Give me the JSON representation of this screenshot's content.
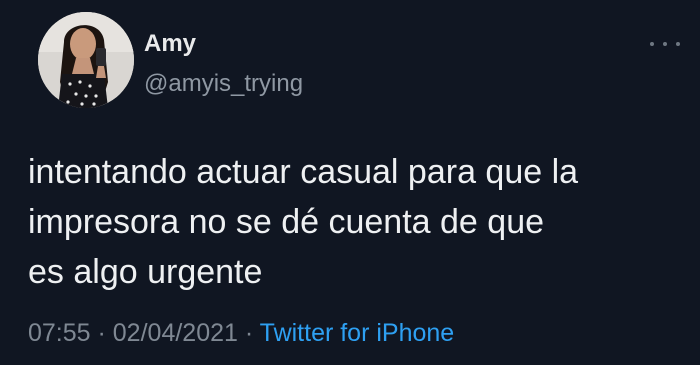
{
  "tweet": {
    "author": {
      "display_name": "Amy",
      "handle": "@amyis_trying"
    },
    "text": "intentando actuar casual para que la\nimpresora no se dé cuenta de que\nes algo urgente",
    "time": "07:55",
    "separator_1": " · ",
    "date": "02/04/2021",
    "separator_2": " · ",
    "source": "Twitter for iPhone"
  },
  "icons": {
    "more": "more-dots-icon",
    "avatar": "avatar-photo"
  },
  "colors": {
    "background": "#101622",
    "primary_text": "#eef0f2",
    "secondary_text": "#8f98a3",
    "link": "#2ea0f2"
  }
}
